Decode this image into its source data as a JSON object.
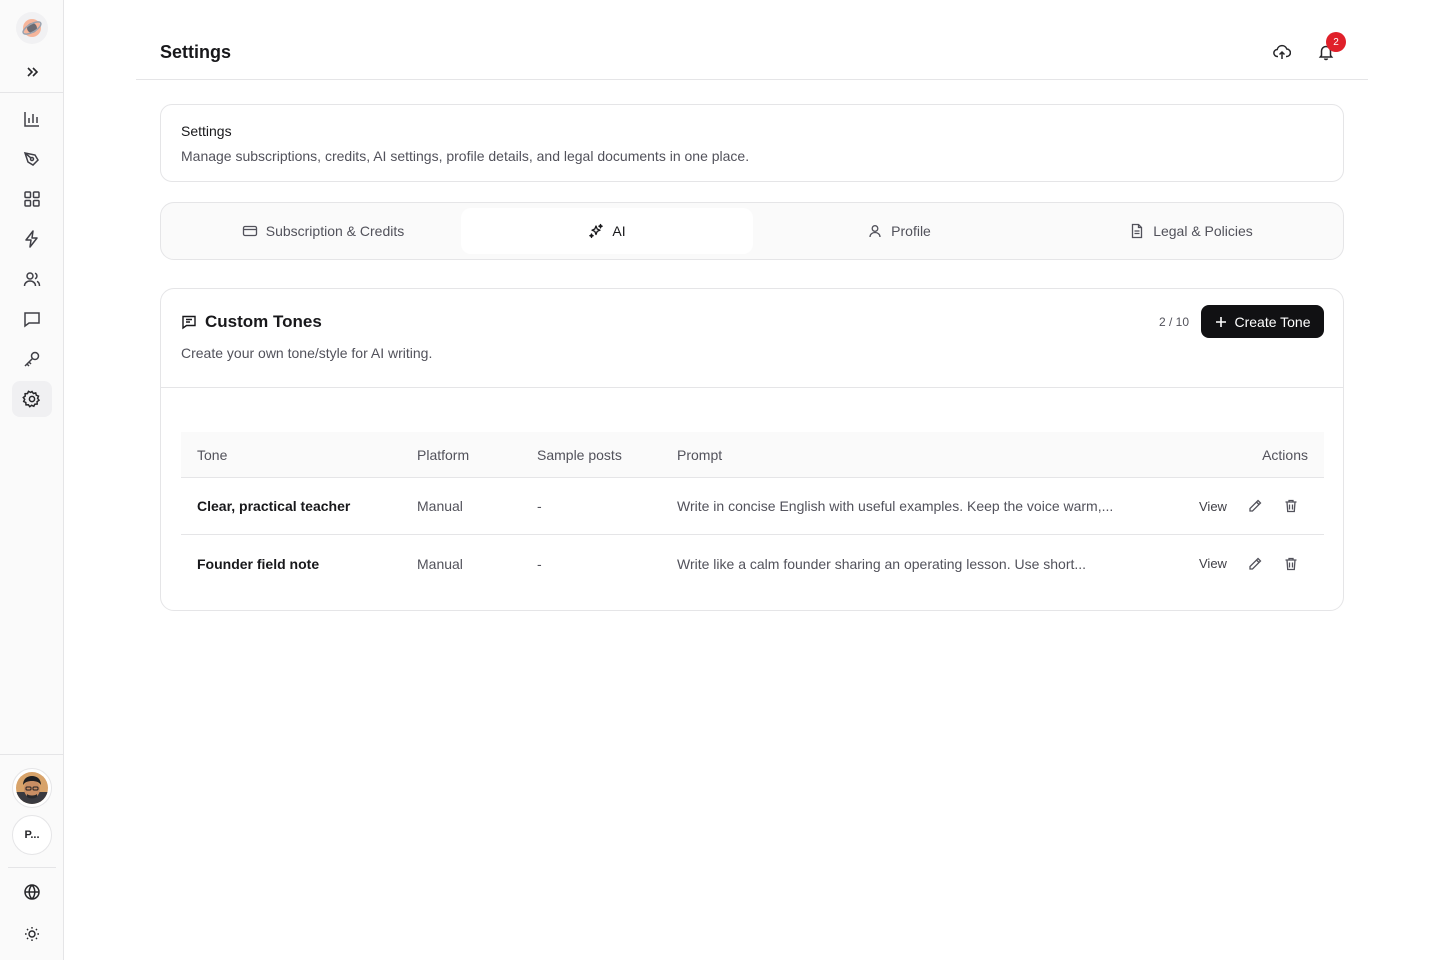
{
  "header": {
    "title": "Settings",
    "notification_count": "2"
  },
  "intro": {
    "title": "Settings",
    "description": "Manage subscriptions, credits, AI settings, profile details, and legal documents in one place."
  },
  "tabs": [
    {
      "label": "Subscription & Credits",
      "icon": "credit-card-icon",
      "active": false
    },
    {
      "label": "AI",
      "icon": "sparkles-icon",
      "active": true
    },
    {
      "label": "Profile",
      "icon": "user-icon",
      "active": false
    },
    {
      "label": "Legal & Policies",
      "icon": "document-icon",
      "active": false
    }
  ],
  "tones": {
    "title": "Custom Tones",
    "description": "Create your own tone/style for AI writing.",
    "count": "2 / 10",
    "create_label": "Create Tone",
    "columns": {
      "tone": "Tone",
      "platform": "Platform",
      "samples": "Sample posts",
      "prompt": "Prompt",
      "actions": "Actions"
    },
    "rows": [
      {
        "tone": "Clear, practical teacher",
        "platform": "Manual",
        "samples": "-",
        "prompt": "Write in concise English with useful examples. Keep the voice warm,...",
        "view": "View"
      },
      {
        "tone": "Founder field note",
        "platform": "Manual",
        "samples": "-",
        "prompt": "Write like a calm founder sharing an operating lesson. Use short...",
        "view": "View"
      }
    ]
  },
  "sidebar": {
    "workspace_label": "P...",
    "nav_icons": [
      "chart-icon",
      "pen-tool-icon",
      "grid-icon",
      "lightning-icon",
      "users-icon",
      "message-icon",
      "key-icon",
      "settings-icon"
    ],
    "bottom_icons": [
      "globe-icon",
      "sun-icon"
    ]
  },
  "colors": {
    "accent": "#111113",
    "badge": "#e0202a",
    "border": "#e5e5e7"
  }
}
